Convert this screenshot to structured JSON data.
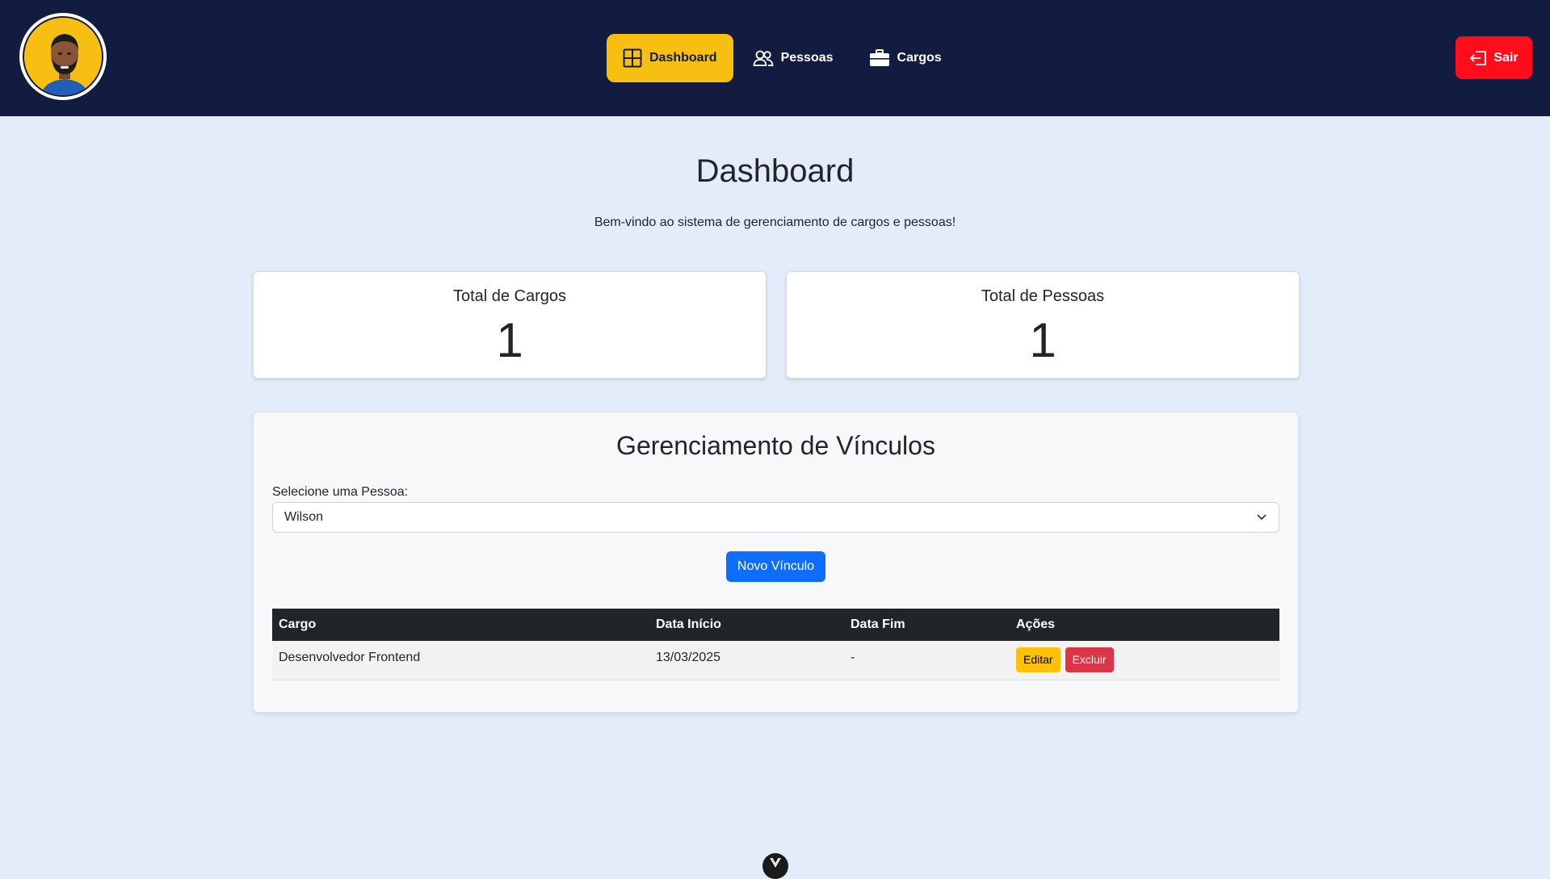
{
  "nav": {
    "items": [
      {
        "label": "Dashboard",
        "icon": "grid-icon"
      },
      {
        "label": "Pessoas",
        "icon": "people-icon"
      },
      {
        "label": "Cargos",
        "icon": "briefcase-icon"
      }
    ],
    "active": "Dashboard",
    "logout_label": "Sair"
  },
  "header": {
    "title": "Dashboard",
    "subtitle": "Bem-vindo ao sistema de gerenciamento de cargos e pessoas!"
  },
  "stats": [
    {
      "label": "Total de Cargos",
      "value": "1"
    },
    {
      "label": "Total de Pessoas",
      "value": "1"
    }
  ],
  "vinculos": {
    "title": "Gerenciamento de Vínculos",
    "select_label": "Selecione uma Pessoa:",
    "selected_person": "Wilson",
    "new_button": "Novo Vínculo",
    "columns": [
      "Cargo",
      "Data Início",
      "Data Fim",
      "Ações"
    ],
    "rows": [
      {
        "cargo": "Desenvolvedor Frontend",
        "inicio": "13/03/2025",
        "fim": "-",
        "edit": "Editar",
        "delete": "Excluir"
      }
    ]
  },
  "colors": {
    "navbar": "#121b40",
    "accent": "#f8bf13",
    "danger": "#ff0d1a",
    "primary": "#0d6efd"
  }
}
